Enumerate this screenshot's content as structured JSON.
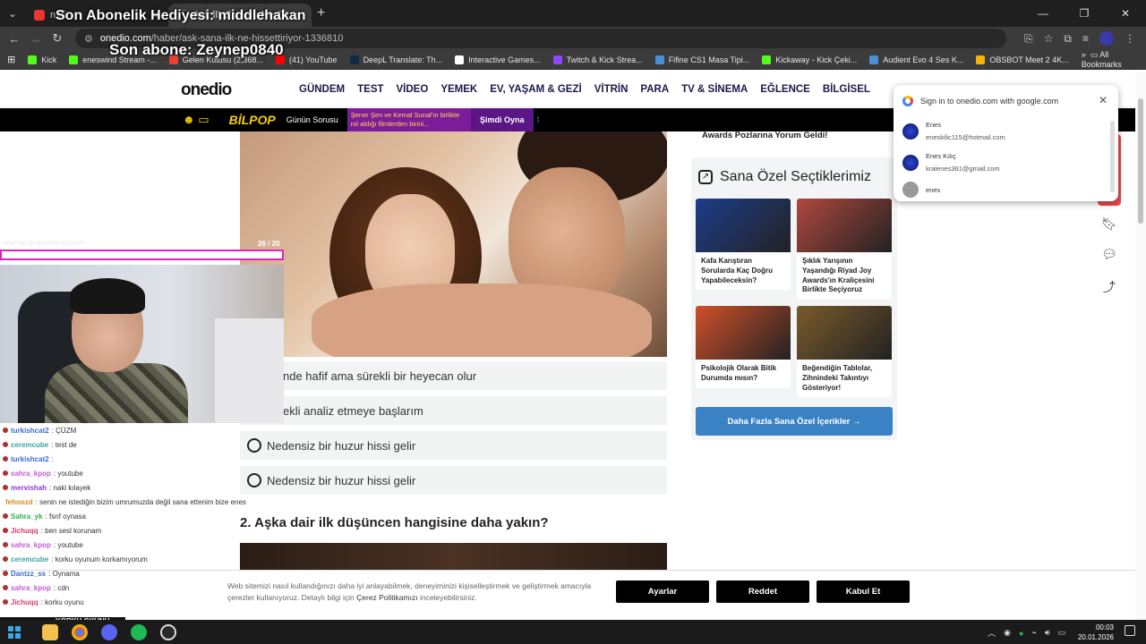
{
  "browser": {
    "tabs": [
      {
        "label": "ruhi"
      },
      {
        "label": "Aşk İlk Zamanı Ne Olmaz? - O"
      }
    ],
    "url_host": "onedio.com",
    "url_path": "/haber/ask-sana-ilk-ne-hissettiriyor-1336810",
    "bookmarks": [
      {
        "label": "Kick",
        "color": "#53fc18"
      },
      {
        "label": "eneswind Stream -...",
        "color": "#53fc18"
      },
      {
        "label": "Gelen Kutusu (2,368...",
        "color": "#ea4335"
      },
      {
        "label": "(41) YouTube",
        "color": "#ff0000"
      },
      {
        "label": "DeepL Translate: Th...",
        "color": "#0f2b46"
      },
      {
        "label": "Interactive Games...",
        "color": "#ffffff"
      },
      {
        "label": "Twitch & Kick Strea...",
        "color": "#9146ff"
      },
      {
        "label": "Fifine CS1 Masa Tipi...",
        "color": "#4a90d9"
      },
      {
        "label": "Kickaway - Kick Çeki...",
        "color": "#53fc18"
      },
      {
        "label": "Audient Evo 4 Ses K...",
        "color": "#4a90d9"
      },
      {
        "label": "OBSBOT Meet 2 4K...",
        "color": "#f5b400"
      }
    ],
    "all_bookmarks": "All Bookmarks"
  },
  "overlay": {
    "gift": "Son Abonelik Hediyesi: middlehakan",
    "last_sub": "Son abone: Zeynep0840",
    "monthly_sub_label": "HAFTALIK ABONE HEDEFİ",
    "korku": "KORKU OYUNU"
  },
  "site": {
    "logo": "onedio",
    "menu": [
      "GÜNDEM",
      "TEST",
      "VİDEO",
      "YEMEK",
      "EV, YAŞAM & GEZİ",
      "VİTRİN",
      "PARA",
      "TV & SİNEMA",
      "EĞLENCE",
      "BİLGİSEL"
    ],
    "bilpop": {
      "brand": "BİLPOP",
      "daily": "Günün Sorusu",
      "question": "Şener Şen ve Kemal Sunal'ın birlikte rol aldığı filmlerden birini...",
      "play": "Şimdi Oyna"
    },
    "counter": "26 / 20",
    "options": [
      "nde hafif ama sürekli bir heyecan olur",
      "ekli analiz etmeye başlarım",
      "Nedensiz bir huzur hissi gelir",
      "Nedensiz bir huzur hissi gelir"
    ],
    "question2": "2. Aşka dair ilk düşüncen hangisine daha yakın?"
  },
  "sidebar": {
    "prev_card": "Awards Pozlarına Yorum Geldi!",
    "panel_title": "Sana Özel Seçtiklerimiz",
    "cards": [
      {
        "title": "Kafa Karıştıran Sorularda Kaç Doğru Yapabileceksin?",
        "color": "#1d3d8a"
      },
      {
        "title": "Şıklık Yarışının Yaşandığı Riyad Joy Awards'ın Kraliçesini Birlikte Seçiyoruz",
        "color": "#b0483f"
      },
      {
        "title": "Psikolojik Olarak Bitik Durumda mısın?",
        "color": "#d0502a"
      },
      {
        "title": "Beğendiğin Tablolar, Zihnindeki Takıntıyı Gösteriyor!",
        "color": "#7a5a2a"
      }
    ],
    "more_button": "Daha Fazla Sana Özel İçerikler →"
  },
  "google_popup": {
    "title": "Sign in to onedio.com with google.com",
    "accounts": [
      {
        "name": "Enes",
        "email": "eneskilic115@hotmail.com"
      },
      {
        "name": "Enes Kılıç",
        "email": "kralenes361@gmail.com"
      },
      {
        "name": "enes",
        "email": ""
      }
    ]
  },
  "chat": [
    {
      "user": "turkishcat2",
      "msg": ": ÇÜZM",
      "color": "#3b6cd6"
    },
    {
      "user": "ceremcube",
      "msg": ": test de",
      "color": "#3aa3a3"
    },
    {
      "user": "turkishcat2",
      "msg": ":",
      "color": "#3b6cd6"
    },
    {
      "user": "sahra_kpop",
      "msg": ": youtube",
      "color": "#c25ad6"
    },
    {
      "user": "mervishah",
      "msg": ": naki kılayek",
      "color": "#8a3ad6"
    },
    {
      "user": "fehoozd",
      "msg": ": senin ne istediğin bizim umrumuzda değil sana ettenim bize enes",
      "color": "#d68a1a"
    },
    {
      "user": "Sahra_yk",
      "msg": ": fsnf oynasa",
      "color": "#2ab34a"
    },
    {
      "user": "Jichuqq",
      "msg": ": ben sesl korunam",
      "color": "#d63a6a"
    },
    {
      "user": "sahra_kpop",
      "msg": ": youtube",
      "color": "#c25ad6"
    },
    {
      "user": "ceremcube",
      "msg": ": korku oyunum korkamıyorum",
      "color": "#3aa3a3"
    },
    {
      "user": "Dantzz_ss",
      "msg": ": Oynama",
      "color": "#3b6cd6"
    },
    {
      "user": "sahra_kpop",
      "msg": ": cdn",
      "color": "#c25ad6"
    },
    {
      "user": "Jichuqq",
      "msg": ": korku oyunu",
      "color": "#d63a6a"
    }
  ],
  "cookie": {
    "text_a": "Web sitemizi nasıl kullandığınızı daha iyi anlayabilmek, deneyiminizi kişiselleştirmek ve geliştirmek amacıyla çerezler kullanıyoruz. Detaylı bilgi için ",
    "link": "Çerez Politikamızı",
    "text_b": " inceleyebilirsiniz.",
    "settings": "Ayarlar",
    "reject": "Reddet",
    "accept": "Kabul Et"
  },
  "taskbar": {
    "time": "00:03",
    "date": "20.01.2026"
  }
}
